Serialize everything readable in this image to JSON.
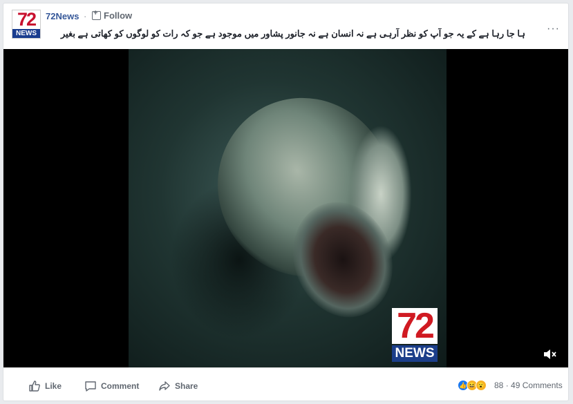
{
  "post": {
    "page_name": "72News",
    "separator": "·",
    "follow_label": "Follow",
    "more_label": "···",
    "caption": "ہا جا رہا ہے کے یہ جو آپ کو نظر آرہی ہے نہ انسان ہے نہ جانور پشاور میں موجود ہے جو کہ رات کو لوگوں کو کھاتی ہے بغیر",
    "logo": {
      "number": "72",
      "word": "NEWS"
    }
  },
  "video": {
    "watermark": {
      "number": "72",
      "word": "NEWS"
    },
    "muted": true
  },
  "footer": {
    "like_label": "Like",
    "comment_label": "Comment",
    "share_label": "Share",
    "reaction_count": "88",
    "comments_label": "49 Comments",
    "count_separator": "·"
  },
  "colors": {
    "link_blue": "#365899",
    "brand_red": "#c8102e",
    "brand_blue": "#1a3d8f"
  }
}
